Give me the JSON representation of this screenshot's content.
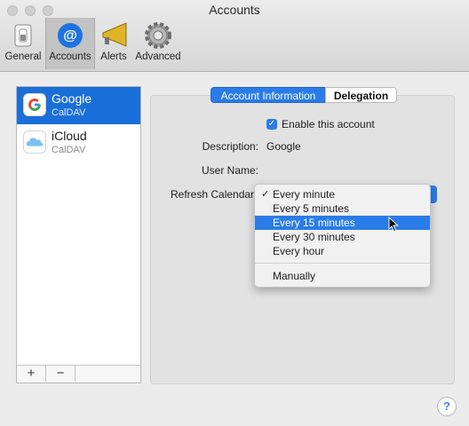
{
  "window": {
    "title": "Accounts"
  },
  "toolbar": {
    "items": [
      {
        "label": "General",
        "icon": "switch-icon"
      },
      {
        "label": "Accounts",
        "icon": "at-sign-icon"
      },
      {
        "label": "Alerts",
        "icon": "megaphone-icon"
      },
      {
        "label": "Advanced",
        "icon": "gear-icon"
      }
    ],
    "selected": "Accounts"
  },
  "sidebar": {
    "accounts": [
      {
        "name": "Google",
        "type": "CalDAV",
        "icon": "google-icon",
        "selected": true
      },
      {
        "name": "iCloud",
        "type": "CalDAV",
        "icon": "icloud-icon",
        "selected": false
      }
    ],
    "add_label": "+",
    "remove_label": "−"
  },
  "tabs": {
    "account_information": "Account Information",
    "delegation": "Delegation"
  },
  "form": {
    "enable_label": "Enable this account",
    "description_label": "Description:",
    "description_value": "Google",
    "username_label": "User Name:",
    "refresh_label": "Refresh Calendars"
  },
  "menu": {
    "items": [
      "Every minute",
      "Every 5 minutes",
      "Every 15 minutes",
      "Every 30 minutes",
      "Every hour",
      "Manually"
    ],
    "checked": "Every minute",
    "highlighted": "Every 15 minutes"
  },
  "help_label": "?",
  "colors": {
    "accent": "#2a7ce8",
    "selection": "#1a6ed8"
  }
}
